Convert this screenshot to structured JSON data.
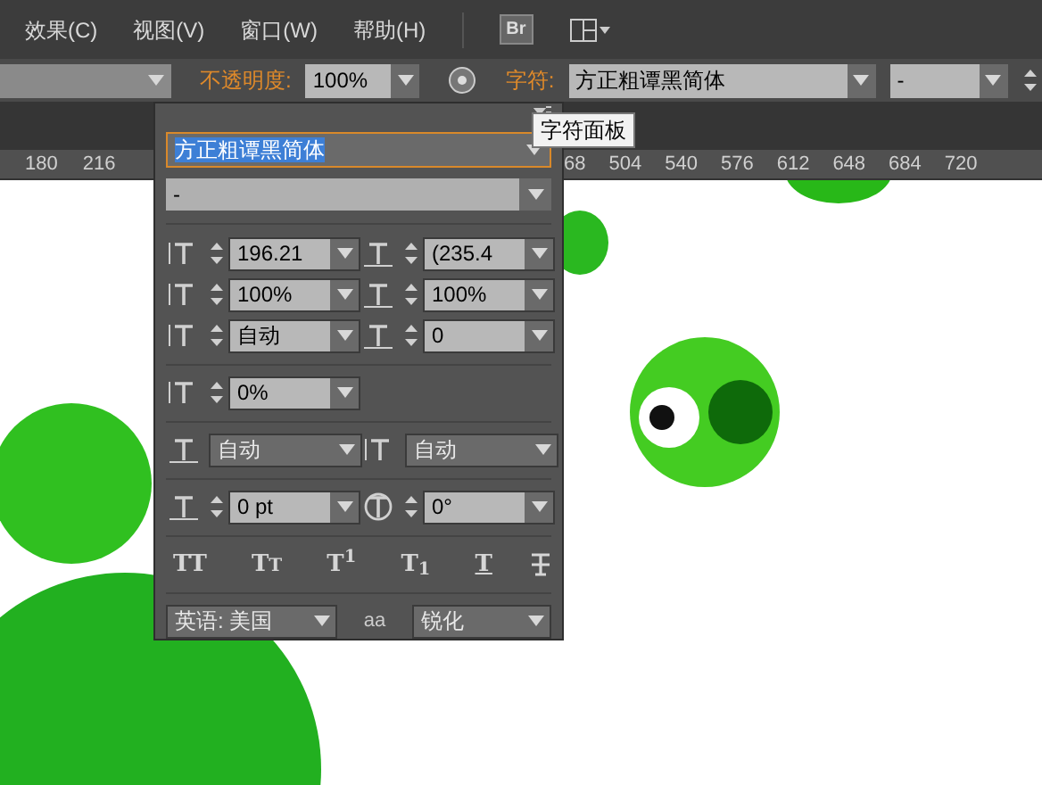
{
  "menu_bar": {
    "items": [
      "效果(C)",
      "视图(V)",
      "窗口(W)",
      "帮助(H)"
    ],
    "bridge_label": "Br"
  },
  "control_bar": {
    "opacity_label": "不透明度:",
    "opacity_value": "100%",
    "character_label": "字符:",
    "font_value": "方正粗谭黑简体",
    "style_value": "-"
  },
  "tooltip": "字符面板",
  "ruler": {
    "left_ticks": [
      "180",
      "216"
    ],
    "right_ticks": [
      "68",
      "504",
      "540",
      "576",
      "612",
      "648",
      "684",
      "720"
    ]
  },
  "character_panel": {
    "font": {
      "value": "方正粗谭黑简体",
      "highlighted": true
    },
    "style": "-",
    "fields": [
      {
        "kind": "spin",
        "value": "196.21"
      },
      {
        "kind": "spin",
        "value": "(235.4"
      },
      {
        "kind": "spin",
        "value": "100%"
      },
      {
        "kind": "spin",
        "value": "100%"
      },
      {
        "kind": "spin",
        "value": "自动"
      },
      {
        "kind": "spin",
        "value": "0"
      },
      {
        "kind": "spin",
        "value": "0%"
      },
      {
        "kind": "select",
        "value": "自动"
      },
      {
        "kind": "select",
        "value": "自动"
      },
      {
        "kind": "spin",
        "value": "0 pt"
      },
      {
        "kind": "spin",
        "value": "0°"
      }
    ],
    "style_buttons": [
      {
        "kind": "all-caps",
        "label": "TT"
      },
      {
        "kind": "small-caps",
        "label": "TT"
      },
      {
        "kind": "superscript",
        "label": "T$^{1}$"
      },
      {
        "kind": "subscript",
        "label": "T$_{1}$"
      },
      {
        "kind": "underline",
        "label": "T"
      },
      {
        "kind": "strikethrough"
      }
    ],
    "language": "英语: 美国",
    "antialias_label": "aa",
    "antialias": "锐化"
  }
}
